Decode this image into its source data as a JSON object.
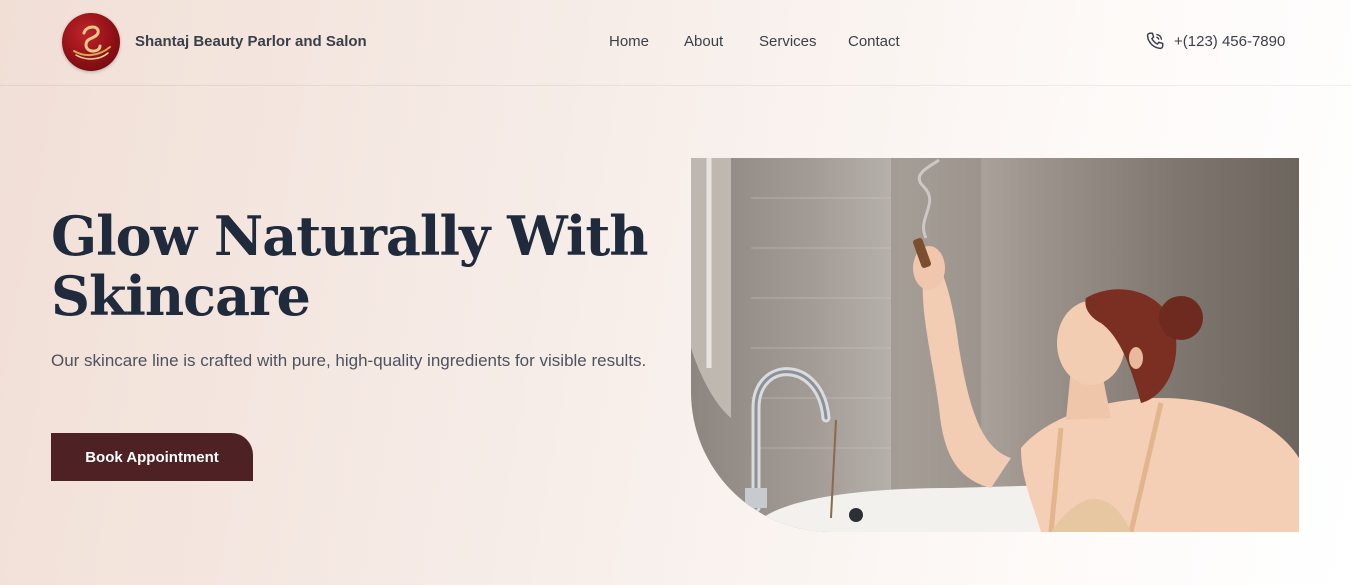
{
  "brand": {
    "name": "Shantaj Beauty Parlor and Salon",
    "logo_icon": "salon-logo"
  },
  "nav": {
    "items": [
      "Home",
      "About",
      "Services",
      "Contact"
    ]
  },
  "contact": {
    "phone": "+(123) 456-7890",
    "icon": "phone-icon"
  },
  "hero": {
    "title": "Glow Naturally With Skincare",
    "subtitle": "Our skincare line is crafted with pure, high-quality ingredients for visible results.",
    "cta_label": "Book Appointment",
    "image": "woman-in-bath-with-incense-photo"
  },
  "colors": {
    "primary_button": "#4e2224",
    "heading": "#1f2a3c",
    "body_text": "#4d5260",
    "logo_red": "#8a0f14"
  }
}
